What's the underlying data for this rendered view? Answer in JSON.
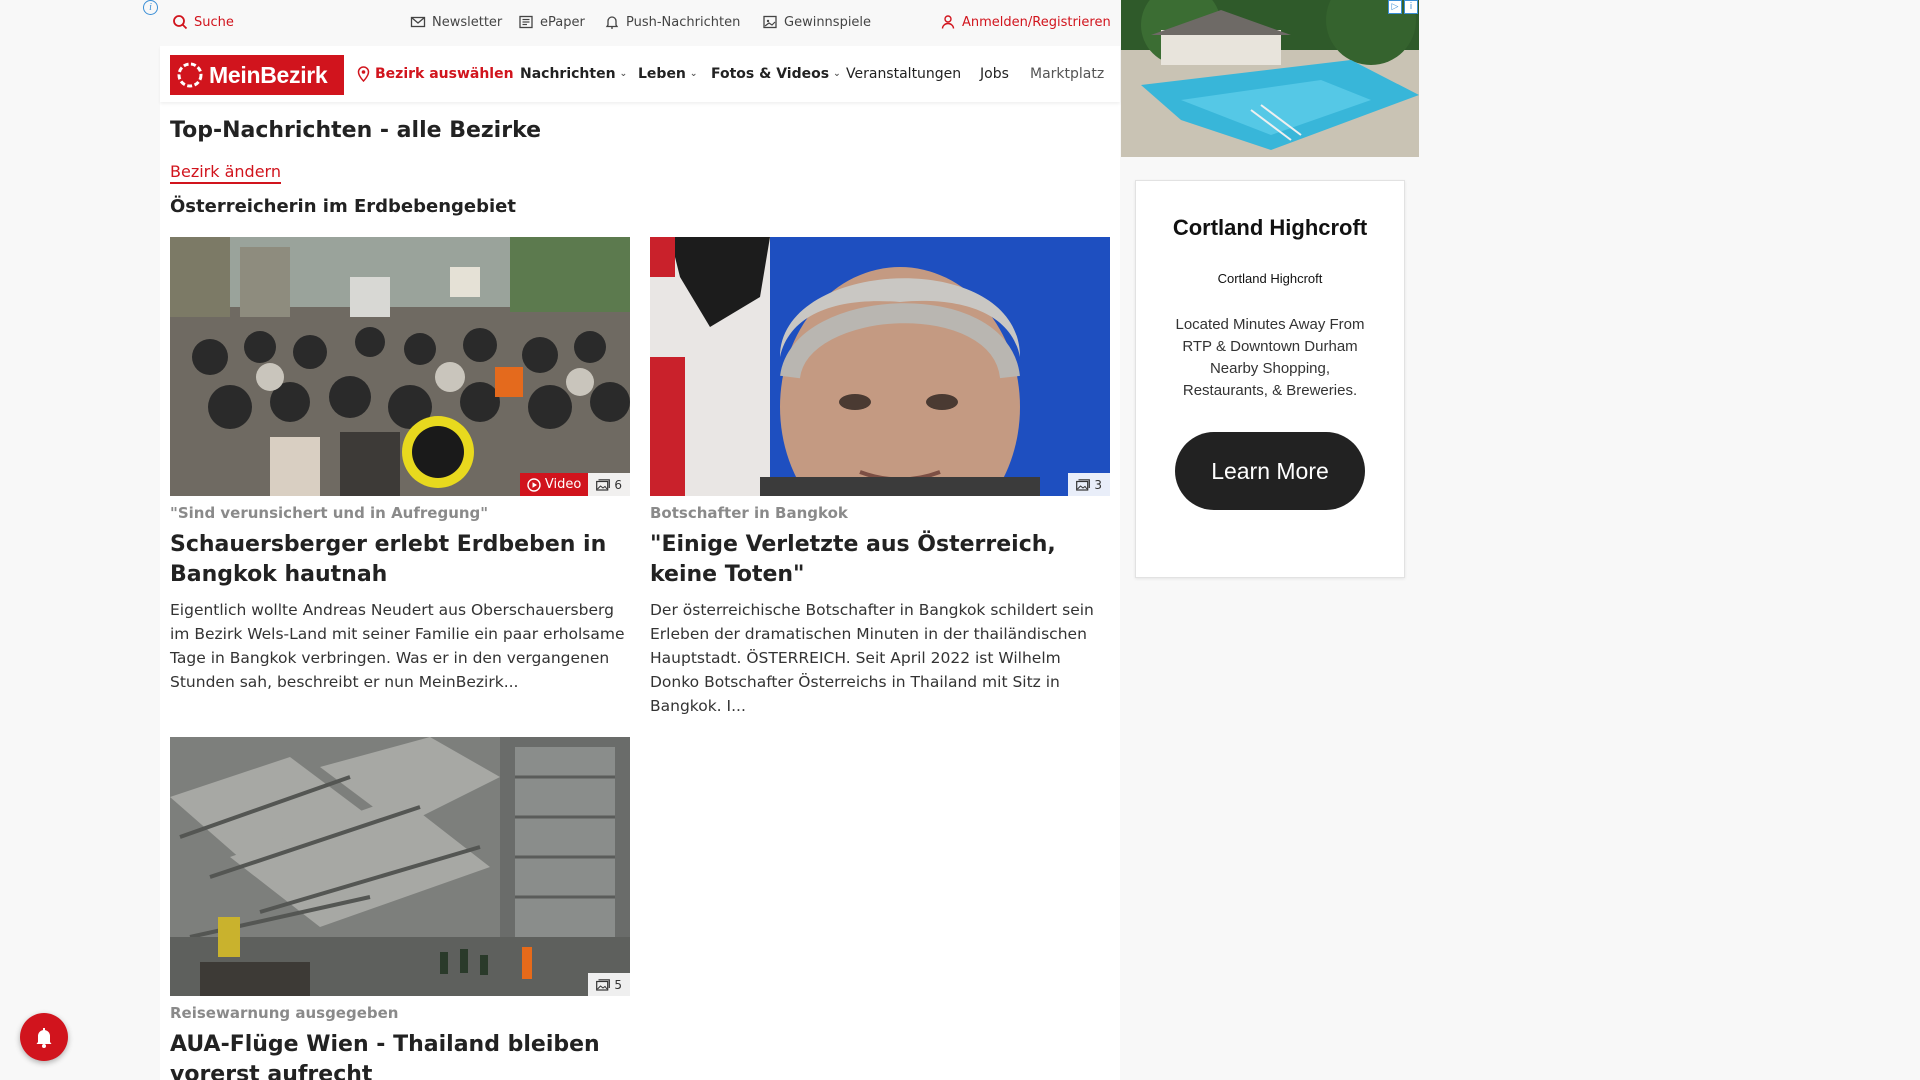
{
  "utility_bar": {
    "search_label": "Suche",
    "newsletter_label": "Newsletter",
    "epaper_label": "ePaper",
    "push_label": "Push-Nachrichten",
    "gewinnspiele_label": "Gewinnspiele",
    "login_label": "Anmelden/Registrieren"
  },
  "nav": {
    "logo_text": "MeinBezirk",
    "bezirk_label": "Bezirk auswählen",
    "items": [
      {
        "label": "Nachrichten"
      },
      {
        "label": "Leben"
      },
      {
        "label": "Fotos & Videos"
      },
      {
        "label": "Veranstaltungen"
      },
      {
        "label": "Jobs"
      },
      {
        "label": "Marktplatz"
      }
    ]
  },
  "main": {
    "page_title": "Top-Nachrichten - alle Bezirke",
    "change_bezirk": "Bezirk ändern",
    "section_title": "Österreicherin im Erdbebengebiet",
    "articles": [
      {
        "kicker": "\"Sind verunsichert und in Aufregung\"",
        "title": "Schauersberger erlebt Erdbeben in Bangkok hautnah",
        "teaser": "Eigentlich wollte Andreas Neudert aus Oberschauersberg im Bezirk Wels-Land mit seiner Familie ein paar erholsame Tage in Bangkok verbringen. Was er in den vergangenen Stunden sah, beschreibt er nun MeinBezirk...",
        "video_label": "Video",
        "image_count": "6"
      },
      {
        "kicker": "Botschafter in Bangkok",
        "title": "\"Einige Verletzte aus Österreich, keine Toten\"",
        "teaser": "Der österreichische Botschafter in Bangkok schildert sein Erleben der dramatischen Minuten in der thailändischen Hauptstadt. ÖSTERREICH. Seit April 2022 ist Wilhelm Donko Botschafter Österreichs in Thailand mit Sitz in Bangkok. I...",
        "image_count": "3"
      },
      {
        "kicker": "Reisewarnung ausgegeben",
        "title": "AUA-Flüge Wien - Thailand bleiben vorerst aufrecht",
        "image_count": "5"
      }
    ]
  },
  "ad": {
    "headline": "Cortland Highcroft",
    "sub": "Cortland Highcroft",
    "description": "Located Minutes Away From RTP & Downtown Durham Nearby Shopping, Restaurants, & Breweries.",
    "cta": "Learn More"
  },
  "colors": {
    "brand_red": "#d1141d",
    "cta_dark": "#222222"
  },
  "icons": [
    "search-icon",
    "mail-icon",
    "epaper-icon",
    "bell-icon",
    "gift-icon",
    "user-icon",
    "pin-icon",
    "chevron-down-icon",
    "play-icon",
    "gallery-icon",
    "info-icon",
    "adchoices-icon"
  ]
}
